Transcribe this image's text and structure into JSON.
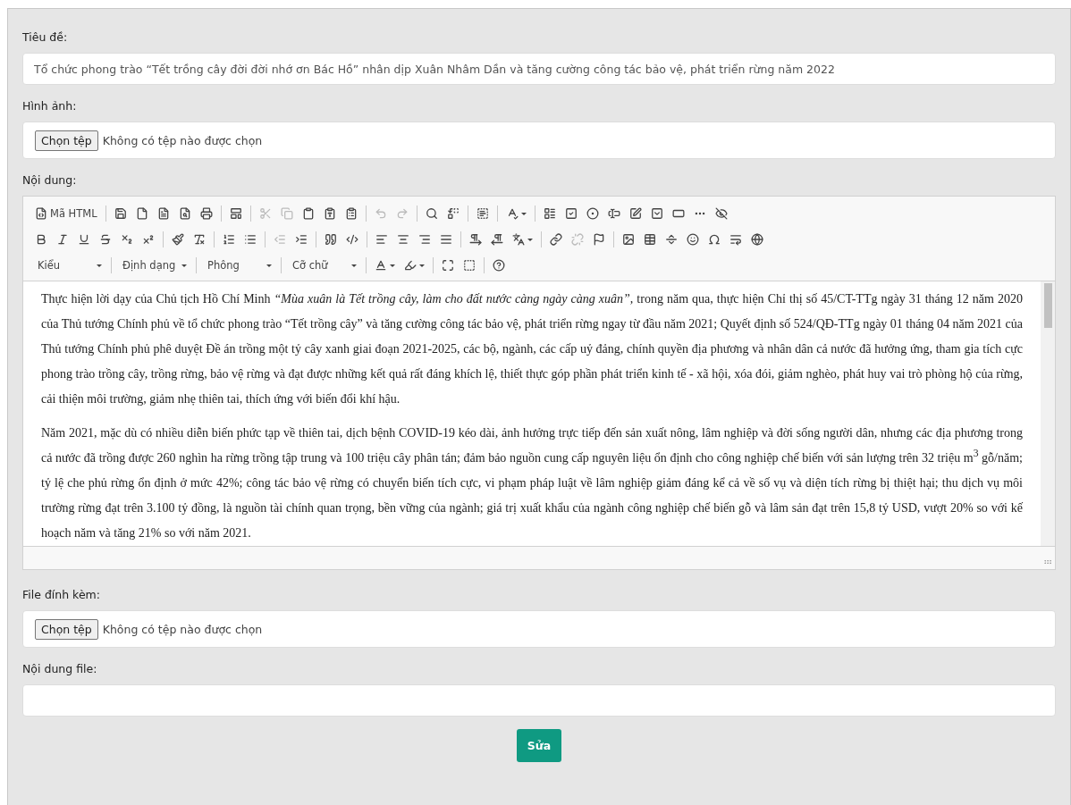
{
  "title_field": {
    "label": "Tiêu đề:",
    "value": "Tổ chức phong trào “Tết trồng cây đời đời nhớ ơn Bác Hồ” nhân dịp Xuân Nhâm Dần và tăng cường công tác bảo vệ, phát triển rừng năm 2022"
  },
  "image_field": {
    "label": "Hình ảnh:",
    "button": "Chọn tệp",
    "status": "Không có tệp nào được chọn"
  },
  "content_field": {
    "label": "Nội dung:",
    "toolbar_rows": [
      [
        [
          {
            "kind": "source",
            "label": "Mã HTML",
            "disabled": false
          }
        ],
        [
          {
            "kind": "save",
            "disabled": false
          },
          {
            "kind": "newpage",
            "disabled": false
          },
          {
            "kind": "pdf",
            "disabled": false
          },
          {
            "kind": "preview",
            "disabled": false
          },
          {
            "kind": "print",
            "disabled": false
          }
        ],
        [
          {
            "kind": "templates",
            "disabled": false
          }
        ],
        [
          {
            "kind": "cut",
            "disabled": true
          },
          {
            "kind": "copy",
            "disabled": true
          },
          {
            "kind": "paste",
            "disabled": false
          },
          {
            "kind": "pastetext",
            "disabled": false
          },
          {
            "kind": "pasteword",
            "disabled": false
          }
        ],
        [
          {
            "kind": "undo",
            "disabled": true
          },
          {
            "kind": "redo",
            "disabled": true
          }
        ],
        [
          {
            "kind": "find",
            "disabled": false
          },
          {
            "kind": "replace",
            "disabled": false
          }
        ],
        [
          {
            "kind": "selectall",
            "disabled": false
          }
        ],
        [
          {
            "kind": "spellcheck",
            "disabled": false,
            "caret": true
          }
        ],
        [
          {
            "kind": "form",
            "disabled": false
          },
          {
            "kind": "checkbox",
            "disabled": false
          },
          {
            "kind": "radio",
            "disabled": false
          },
          {
            "kind": "textfield",
            "disabled": false
          },
          {
            "kind": "textarea",
            "disabled": false
          },
          {
            "kind": "select",
            "disabled": false
          },
          {
            "kind": "button",
            "disabled": false
          },
          {
            "kind": "imagebutton",
            "disabled": false
          },
          {
            "kind": "hiddenfield",
            "disabled": false
          }
        ]
      ],
      [
        [
          {
            "kind": "bold",
            "disabled": false
          },
          {
            "kind": "italic",
            "disabled": false
          },
          {
            "kind": "underline",
            "disabled": false
          },
          {
            "kind": "strike",
            "disabled": false
          },
          {
            "kind": "subscript",
            "disabled": false
          },
          {
            "kind": "superscript",
            "disabled": false
          }
        ],
        [
          {
            "kind": "copyformat",
            "disabled": false
          },
          {
            "kind": "removeformat",
            "disabled": false
          }
        ],
        [
          {
            "kind": "numlist",
            "disabled": false
          },
          {
            "kind": "bulletlist",
            "disabled": false
          }
        ],
        [
          {
            "kind": "outdent",
            "disabled": true
          },
          {
            "kind": "indent",
            "disabled": false
          }
        ],
        [
          {
            "kind": "blockquote",
            "disabled": false
          },
          {
            "kind": "creatediv",
            "disabled": false
          }
        ],
        [
          {
            "kind": "alignleft",
            "disabled": false
          },
          {
            "kind": "aligncenter",
            "disabled": false
          },
          {
            "kind": "alignright",
            "disabled": false
          },
          {
            "kind": "justify",
            "disabled": false
          }
        ],
        [
          {
            "kind": "ltr",
            "disabled": false
          },
          {
            "kind": "rtl",
            "disabled": false
          },
          {
            "kind": "language",
            "disabled": false,
            "caret": true
          }
        ],
        [
          {
            "kind": "link",
            "disabled": false
          },
          {
            "kind": "unlink",
            "disabled": true
          },
          {
            "kind": "anchor",
            "disabled": false
          }
        ],
        [
          {
            "kind": "image",
            "disabled": false
          },
          {
            "kind": "table",
            "disabled": false
          },
          {
            "kind": "hr",
            "disabled": false
          },
          {
            "kind": "smiley",
            "disabled": false
          },
          {
            "kind": "specialchar",
            "disabled": false
          },
          {
            "kind": "pagebreak",
            "disabled": false
          },
          {
            "kind": "iframe",
            "disabled": false
          }
        ]
      ]
    ],
    "combos": [
      "Kiểu",
      "Định dạng",
      "Phông",
      "Cỡ chữ"
    ],
    "toolbar_tail": [
      [
        {
          "kind": "textcolor",
          "disabled": false,
          "caret": true
        },
        {
          "kind": "bgcolor",
          "disabled": false,
          "caret": true
        }
      ],
      [
        {
          "kind": "maximize",
          "disabled": false
        },
        {
          "kind": "showblocks",
          "disabled": false
        }
      ],
      [
        {
          "kind": "about",
          "disabled": false
        }
      ]
    ],
    "paragraphs": [
      "Thực hiện lời dạy của Chủ tịch Hồ Chí Minh *“Mùa xuân là Tết trồng cây, làm cho đất nước càng ngày càng xuân”,* trong năm qua, thực hiện Chỉ thị số 45/CT-TTg ngày 31 tháng 12 năm 2020 của Thủ tướng Chính phủ về tổ chức phong trào “Tết trồng cây” và tăng cường công tác bảo vệ, phát triển rừng ngay từ đầu năm 2021; Quyết định số 524/QĐ-TTg ngày 01 tháng 04 năm 2021 của Thủ tướng Chính phủ phê duyệt Đề án trồng một tỷ cây xanh giai đoạn 2021-2025, các bộ, ngành, các cấp uỷ đảng, chính quyền địa phương và nhân dân cả nước đã hưởng ứng, tham gia tích cực phong trào trồng cây, trồng rừng, bảo vệ rừng và đạt được những kết quả rất đáng khích lệ, thiết thực góp phần phát triển kinh tế - xã hội, xóa đói, giảm nghèo, phát huy vai trò phòng hộ của rừng, cải thiện môi trường, giảm nhẹ thiên tai, thích ứng với biến đổi khí hậu.",
      "Năm 2021, mặc dù có nhiều diễn biến phức tạp về thiên tai, dịch bệnh COVID-19 kéo dài, ảnh hưởng trực tiếp đến sản xuất nông, lâm nghiệp và đời sống người dân, nhưng các địa phương trong cả nước đã trồng được 260 nghìn ha rừng trồng tập trung và 100 triệu cây phân tán; đảm bảo nguồn cung cấp nguyên liệu ổn định cho công nghiệp chế biến với sản lượng trên 32 triệu m$^{3}$ gỗ/năm; tỷ lệ che phủ rừng ổn định ở mức 42%; công tác bảo vệ rừng có chuyển biến tích cực, vi phạm pháp luật về lâm nghiệp giảm đáng kể cả về số vụ và diện tích rừng bị thiệt hại; thu dịch vụ môi trường rừng đạt trên 3.100 tỷ đồng, là nguồn tài chính quan trọng, bền vững của ngành; giá trị xuất khẩu của ngành công nghiệp chế biến gỗ và lâm sản đạt trên 15,8 tỷ USD, vượt 20% so với kế hoạch năm và tăng 21% so với năm 2021."
    ]
  },
  "attachment_field": {
    "label": "File đính kèm:",
    "button": "Chọn tệp",
    "status": "Không có tệp nào được chọn"
  },
  "file_content_field": {
    "label": "Nội dung file:"
  },
  "submit": "Sửa"
}
